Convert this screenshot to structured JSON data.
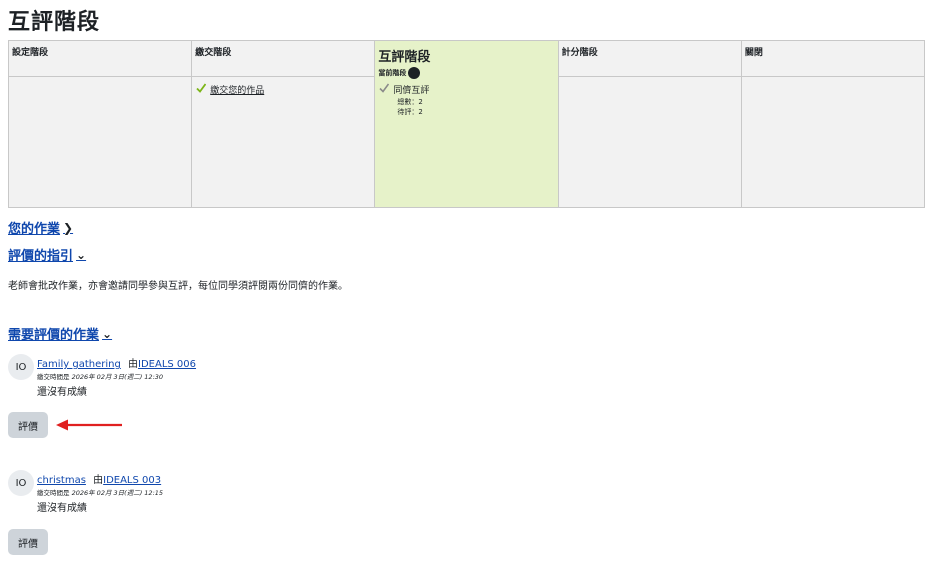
{
  "page": {
    "title": "互評階段"
  },
  "phases": [
    {
      "name": "設定階段",
      "tasks": []
    },
    {
      "name": "繳交階段",
      "tasks": [
        {
          "label": "繳交您的作品",
          "done": true,
          "link": true
        }
      ]
    },
    {
      "name": "互評階段",
      "current_label": "當前階段",
      "active": true,
      "tasks": [
        {
          "label": "同儕互評",
          "done": true,
          "link": false,
          "info": [
            "總數：2",
            "待評：2"
          ]
        }
      ]
    },
    {
      "name": "計分階段",
      "tasks": []
    },
    {
      "name": "關閉",
      "tasks": []
    }
  ],
  "sections": {
    "your_work": "您的作業",
    "assessment_guide": "評價的指引",
    "instructions": "老師會批改作業，亦會邀請同學參與互評，每位同學須評閱兩份同儕的作業。",
    "to_assess": "需要評價的作業"
  },
  "submissions": [
    {
      "avatar": "IO",
      "title": "Family gathering",
      "by_label": "由",
      "author": "IDEALS 006",
      "time_label": "繳交時間是",
      "time": "2026年 02月 3日(週二) 12:30",
      "grade_status": "還沒有成績",
      "button": "評價"
    },
    {
      "avatar": "IO",
      "title": "christmas",
      "by_label": "由",
      "author": "IDEALS 003",
      "time_label": "繳交時間是",
      "time": "2026年 02月 3日(週二) 12:15",
      "grade_status": "還沒有成績",
      "button": "評價"
    }
  ],
  "colors": {
    "accent_link": "#0f47ad",
    "active_phase": "#e6f2c9",
    "check": "#7cb518",
    "arrow": "#e02020"
  },
  "icons": {
    "check": "check-icon",
    "chevron_right": "chevron-right-icon",
    "chevron_down": "chevron-down-icon"
  }
}
